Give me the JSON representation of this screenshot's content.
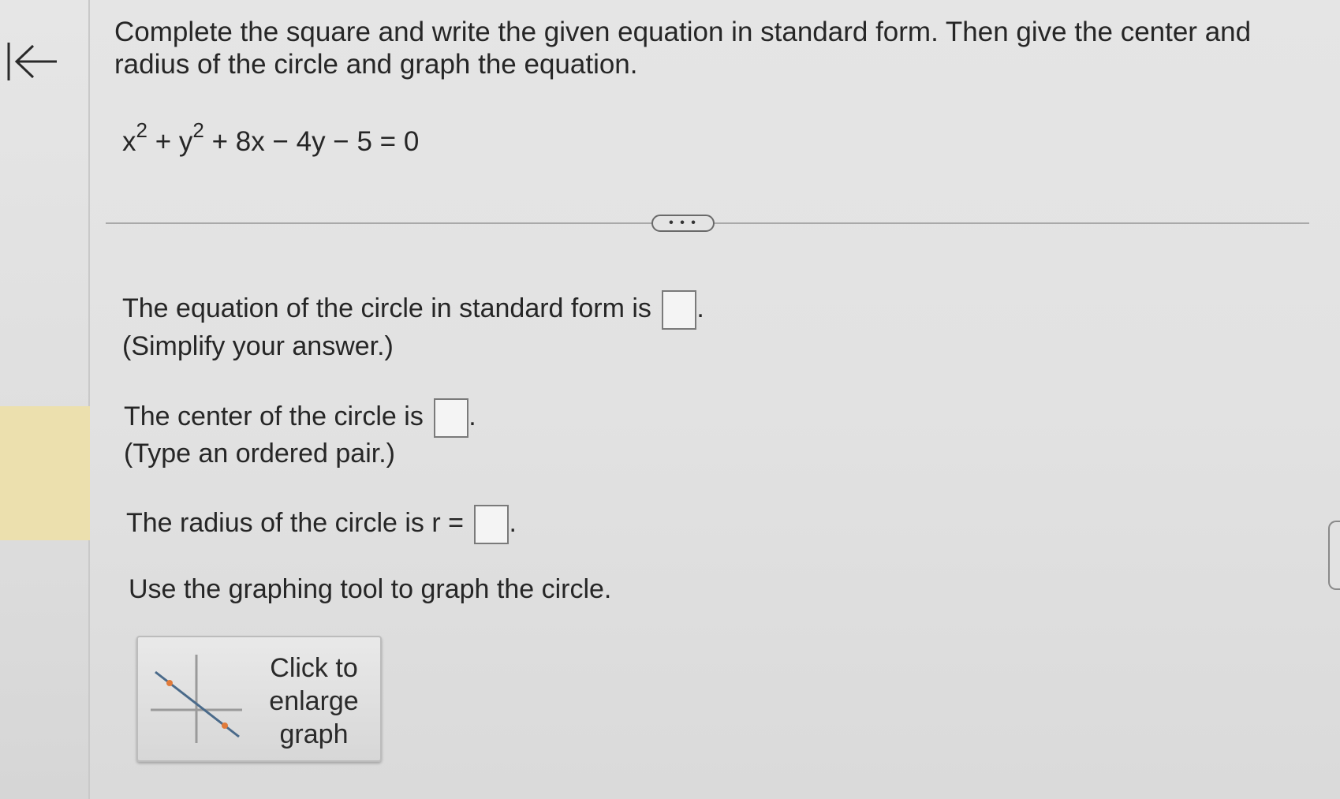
{
  "question": {
    "prompt": "Complete the square and write the given equation in standard form. Then give the center and radius of the circle and graph the equation.",
    "equation": {
      "x_term": "x",
      "x_exp": "2",
      "plus1": "+",
      "y_term": "y",
      "y_exp": "2",
      "rest": "+ 8x − 4y − 5 = 0"
    }
  },
  "more_button_label": "• • •",
  "answers": {
    "standard_form": {
      "label": "The equation of the circle in standard form is",
      "value": "",
      "hint": "(Simplify your answer.)"
    },
    "center": {
      "label": "The center of the circle is",
      "value": "",
      "hint": "(Type an ordered pair.)"
    },
    "radius": {
      "label": "The radius of the circle is r =",
      "value": ""
    },
    "graph_instruction": "Use the graphing tool to graph the circle."
  },
  "graph_button": {
    "line1": "Click to",
    "line2": "enlarge",
    "line3": "graph"
  },
  "icons": {
    "back": "back-arrow-icon",
    "thumbnail": "graph-thumbnail-icon"
  },
  "colors": {
    "highlight": "#ece0ae",
    "point_marker": "#e07a3a"
  }
}
